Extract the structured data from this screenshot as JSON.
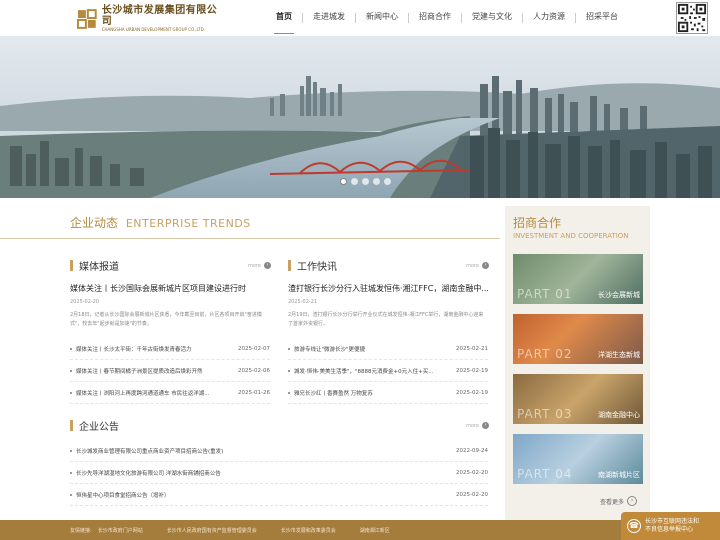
{
  "header": {
    "logo_cn": "长沙城市发展集团有限公司",
    "logo_en": "CHANGSHA URBAN DEVELOPMENT GROUP CO.,LTD.",
    "nav": [
      "首页",
      "走进城发",
      "新闻中心",
      "招商合作",
      "党建与文化",
      "人力资源",
      "招采平台"
    ],
    "active_index": 0
  },
  "hero": {
    "slides": 5,
    "active": 0
  },
  "enterprise": {
    "title_cn": "企业动态",
    "title_en": "ENTERPRISE TRENDS"
  },
  "media": {
    "title": "媒体报道",
    "more": "more",
    "headline": "媒体关注丨长沙国际会展新城片区项目建设进行时",
    "date": "2025-02-20",
    "desc": "2月18日，记者从长沙国际会展新城片区获悉，今年截至目前，片区各项目开启\"奋进模式\"，较去年\"起步就是加速\"的节奏。",
    "items": [
      {
        "title": "媒体关注丨长沙太平街：千年古街焕发青春活力",
        "date": "2025-02-07"
      },
      {
        "title": "媒体关注丨春节期间橘子洲景区提质改造后焕彩开然",
        "date": "2025-02-06"
      },
      {
        "title": "媒体关注丨浏阳河上再度跨河通道通车 市民往返洋湖...",
        "date": "2025-01-26"
      }
    ]
  },
  "work": {
    "title": "工作快讯",
    "more": "more",
    "headline": "渣打银行长沙分行入驻城发恒伟·湘江FFC，湖南金融中...",
    "date": "2025-02-21",
    "desc": "2月19日，渣打银行长沙分行举行开业仪式在城发恒伟·湘江FFC举行，湖南金融中心迎来了首家外资银行。",
    "items": [
      {
        "title": "旅游专线让\"微游长沙\"更便捷",
        "date": "2025-02-21"
      },
      {
        "title": "城发·恒伟·美美生活季\"，\"8888元消费金+0元入住+买...",
        "date": "2025-02-19"
      },
      {
        "title": "雅兄长沙红丨香赛盈然 万物复苏",
        "date": "2025-02-19"
      }
    ]
  },
  "notice": {
    "title": "企业公告",
    "more": "more",
    "items": [
      {
        "title": "长沙城发商业管理有限公司重点商业资产项目招商公告(重发)",
        "date": "2022-09-24"
      },
      {
        "title": "长沙先导洋湖湿地文化旅游有限公司 洋湖水街商铺招商公告",
        "date": "2025-02-20"
      },
      {
        "title": "恒伟星中心项目食堂招商公告（增补）",
        "date": "2025-02-20"
      }
    ]
  },
  "invest": {
    "title_cn": "招商合作",
    "title_en": "INVESTMENT AND COOPERATION",
    "cards": [
      {
        "big": "PART 01",
        "label": "长沙会展新城"
      },
      {
        "big": "PART 02",
        "label": "洋湖生态新城"
      },
      {
        "big": "PART 03",
        "label": "湖南金融中心"
      },
      {
        "big": "PART 04",
        "label": "南湖新城片区"
      }
    ],
    "more": "查看更多"
  },
  "footer": {
    "label": "友情链接:",
    "links": [
      "长沙市政府门户网站",
      "长沙市人民政府国有资产监督管理委员会",
      "长沙市发展和改革委员会",
      "湖南湘江新区"
    ]
  },
  "report": {
    "line1": "长沙市互联网违法和",
    "line2": "不良信息举报中心"
  },
  "colors": {
    "accent": "#b58a3d",
    "footer": "#a47c3c"
  }
}
